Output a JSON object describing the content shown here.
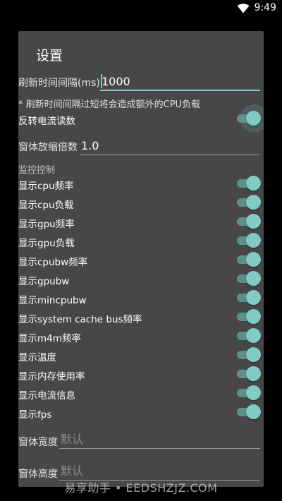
{
  "status_bar": {
    "time": "9:49",
    "icons": [
      "wifi-icon",
      "battery-icon"
    ]
  },
  "dialog": {
    "title": "设置",
    "refresh": {
      "label": "刷新时间间隔(ms)",
      "value": "1000"
    },
    "hint": "* 刷新时间间隔过短将会造成额外的CPU负载",
    "reverse_current": {
      "label": "反转电流读数",
      "on": true
    },
    "scale": {
      "label": "窗体放缩倍数",
      "value": "1.0"
    },
    "monitor_section": "监控控制",
    "switches": [
      {
        "label": "显示cpu频率",
        "on": true
      },
      {
        "label": "显示cpu负载",
        "on": true
      },
      {
        "label": "显示gpu频率",
        "on": true
      },
      {
        "label": "显示gpu负载",
        "on": true
      },
      {
        "label": "显示cpubw频率",
        "on": true
      },
      {
        "label": "显示gpubw",
        "on": true
      },
      {
        "label": "显示mincpubw",
        "on": true
      },
      {
        "label": "显示system cache bus频率",
        "on": true
      },
      {
        "label": "显示m4m频率",
        "on": true
      },
      {
        "label": "显示温度",
        "on": true
      },
      {
        "label": "显示内存使用率",
        "on": true
      },
      {
        "label": "显示电流信息",
        "on": true
      },
      {
        "label": "显示fps",
        "on": true
      }
    ],
    "width": {
      "label": "窗体宽度",
      "placeholder": "默认"
    },
    "height": {
      "label": "窗体高度",
      "placeholder": "默认"
    }
  },
  "watermark": "易享助手 • EEDSHZJZ.COM",
  "colors": {
    "accent": "#80cbc4",
    "dialog_bg": "#474747",
    "track_on": "#5f8f8b"
  }
}
